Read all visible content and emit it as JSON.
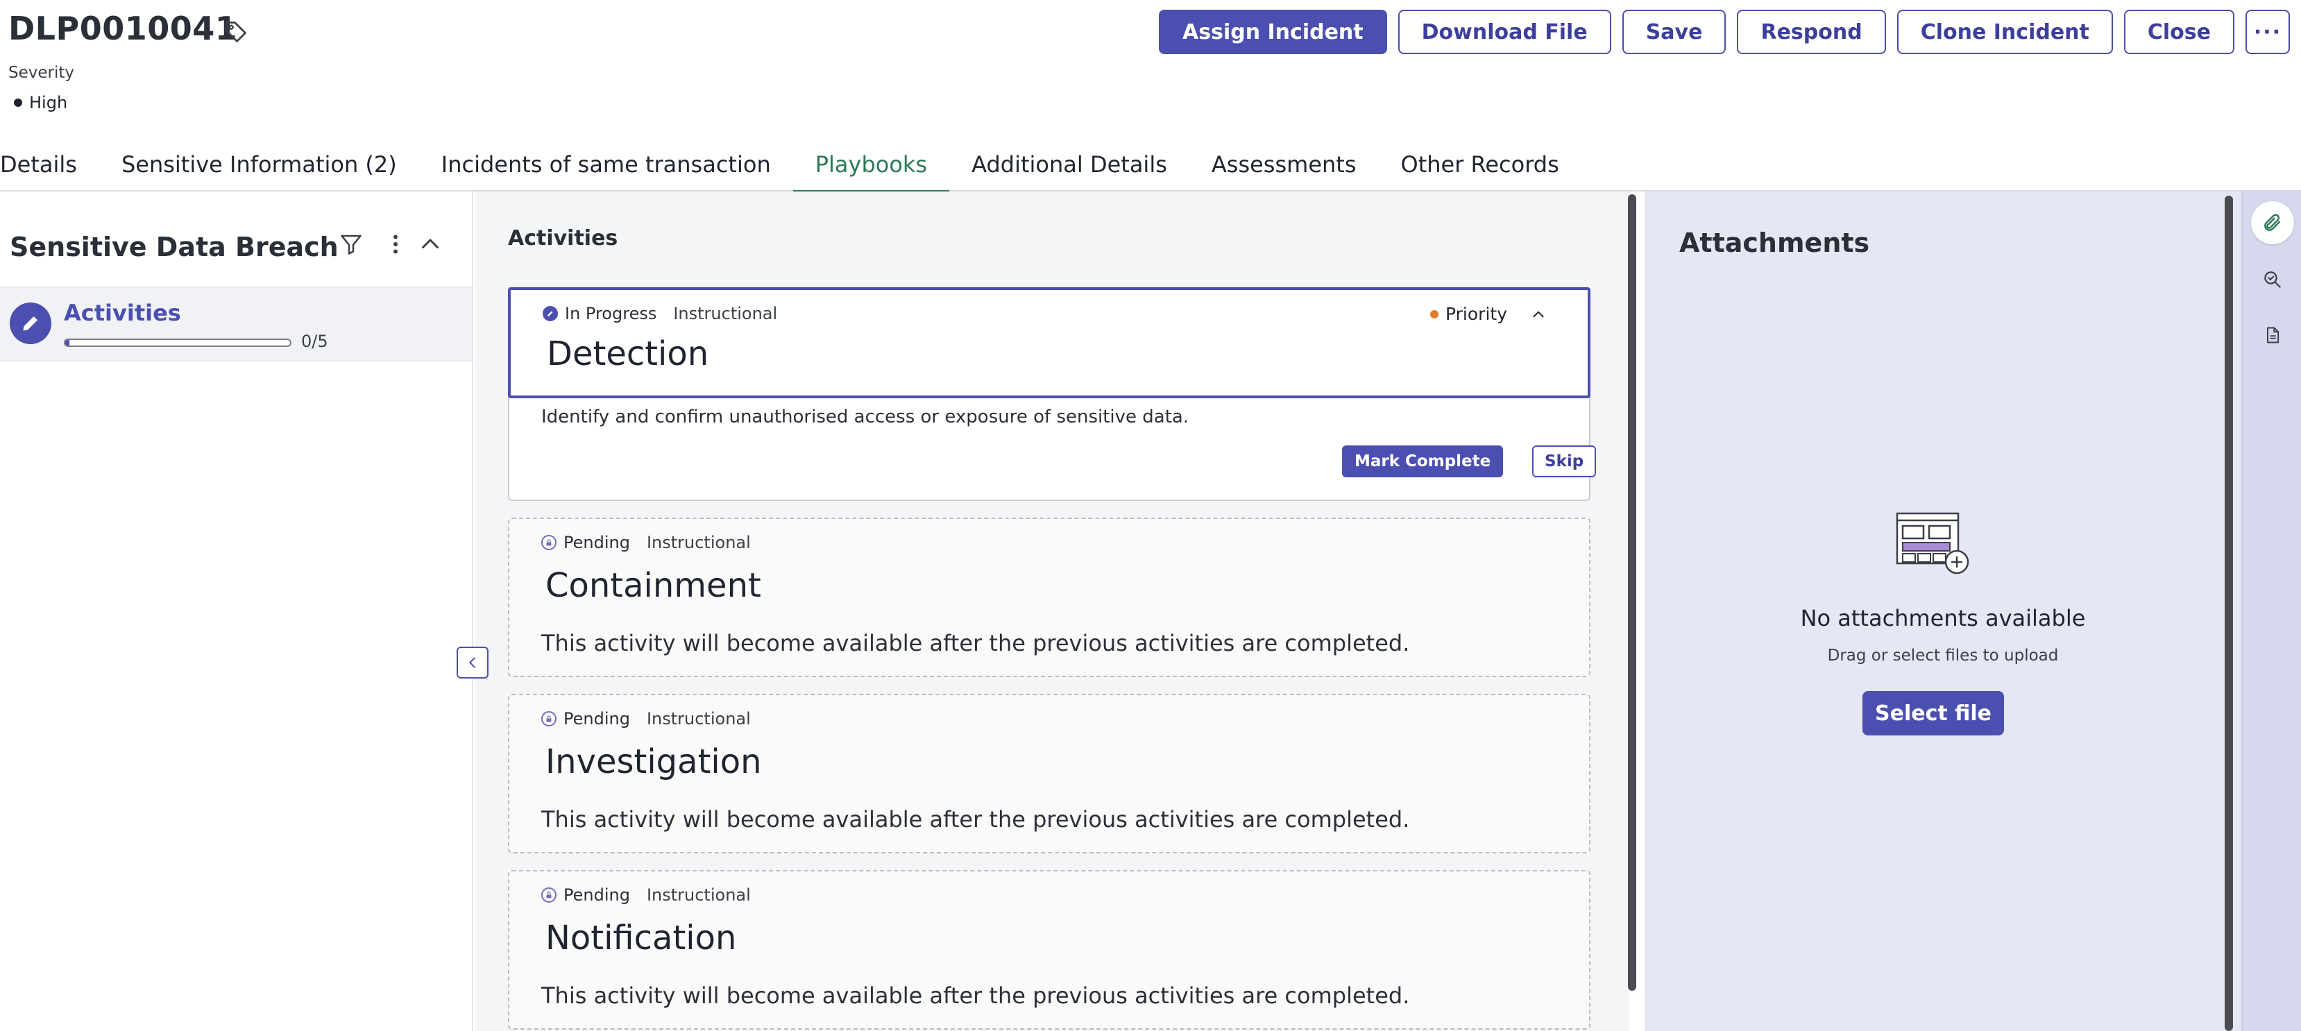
{
  "incident": {
    "id": "DLP0010041",
    "severity_label": "Severity",
    "severity_value": "High"
  },
  "actions": {
    "assign": "Assign Incident",
    "download": "Download File",
    "save": "Save",
    "respond": "Respond",
    "clone": "Clone Incident",
    "close": "Close",
    "more": "···"
  },
  "tabs": [
    {
      "label": "Details"
    },
    {
      "label": "Sensitive Information (2)"
    },
    {
      "label": "Incidents of same transaction"
    },
    {
      "label": "Playbooks"
    },
    {
      "label": "Additional Details"
    },
    {
      "label": "Assessments"
    },
    {
      "label": "Other Records"
    }
  ],
  "left_panel": {
    "title": "Sensitive Data Breach",
    "activities_label": "Activities",
    "progress_count": "0/5",
    "progress_fraction": 0.02
  },
  "middle": {
    "title": "Activities",
    "cards": [
      {
        "status": "In Progress",
        "type": "Instructional",
        "title": "Detection",
        "priority": "Priority",
        "description": "Identify and confirm unauthorised access or exposure of sensitive data.",
        "mark_complete": "Mark Complete",
        "skip": "Skip"
      },
      {
        "status": "Pending",
        "type": "Instructional",
        "title": "Containment",
        "message": "This activity will become available after the previous activities are completed."
      },
      {
        "status": "Pending",
        "type": "Instructional",
        "title": "Investigation",
        "message": "This activity will become available after the previous activities are completed."
      },
      {
        "status": "Pending",
        "type": "Instructional",
        "title": "Notification",
        "message": "This activity will become available after the previous activities are completed."
      }
    ]
  },
  "attachments": {
    "title": "Attachments",
    "empty": "No attachments available",
    "hint": "Drag or select files to upload",
    "select_button": "Select file"
  },
  "colors": {
    "brand": "#4b4fb0",
    "active_tab": "#2c7a57",
    "priority_dot": "#e07b2a"
  }
}
